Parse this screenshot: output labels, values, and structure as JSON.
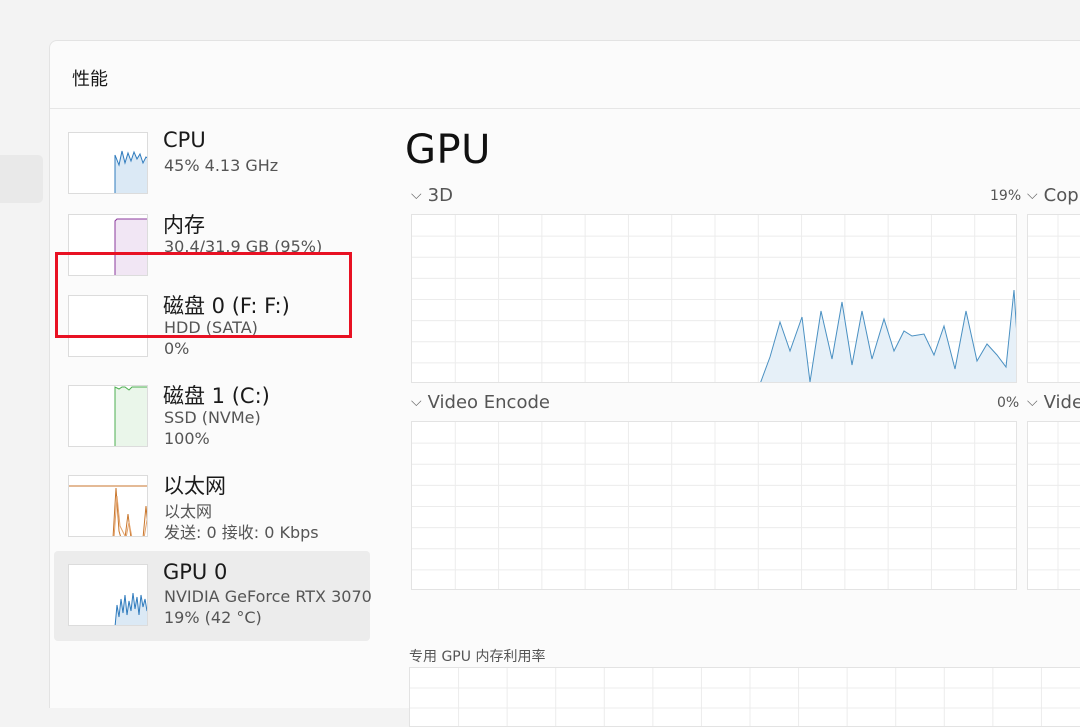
{
  "page": {
    "title": "性能"
  },
  "sidebar": {
    "items": [
      {
        "title": "CPU",
        "line1": "45% 4.13 GHz",
        "line2": "",
        "color": "#2f7bbd"
      },
      {
        "title": "内存",
        "line1": "30.4/31.9 GB (95%)",
        "line2": "",
        "color": "#8b3a9c"
      },
      {
        "title": "磁盘 0 (F: F:)",
        "line1": "HDD (SATA)",
        "line2": "0%",
        "color": "#4caf50"
      },
      {
        "title": "磁盘 1 (C:)",
        "line1": "SSD (NVMe)",
        "line2": "100%",
        "color": "#4caf50"
      },
      {
        "title": "以太网",
        "line1": "以太网",
        "line2": "发送: 0 接收: 0 Kbps",
        "color": "#c8762c"
      },
      {
        "title": "GPU 0",
        "line1": "NVIDIA GeForce RTX 3070",
        "line2": "19% (42 °C)",
        "color": "#2f7bbd"
      }
    ]
  },
  "main": {
    "title": "GPU",
    "engines": [
      {
        "name": "3D",
        "percent": "19%"
      },
      {
        "name": "Cop",
        "percent": ""
      },
      {
        "name": "Video Encode",
        "percent": "0%"
      },
      {
        "name": "Vide",
        "percent": ""
      }
    ],
    "memory_label": "专用 GPU 内存利用率"
  },
  "colors": {
    "highlight": "#e81123",
    "gpu_line": "#4a90c2"
  }
}
